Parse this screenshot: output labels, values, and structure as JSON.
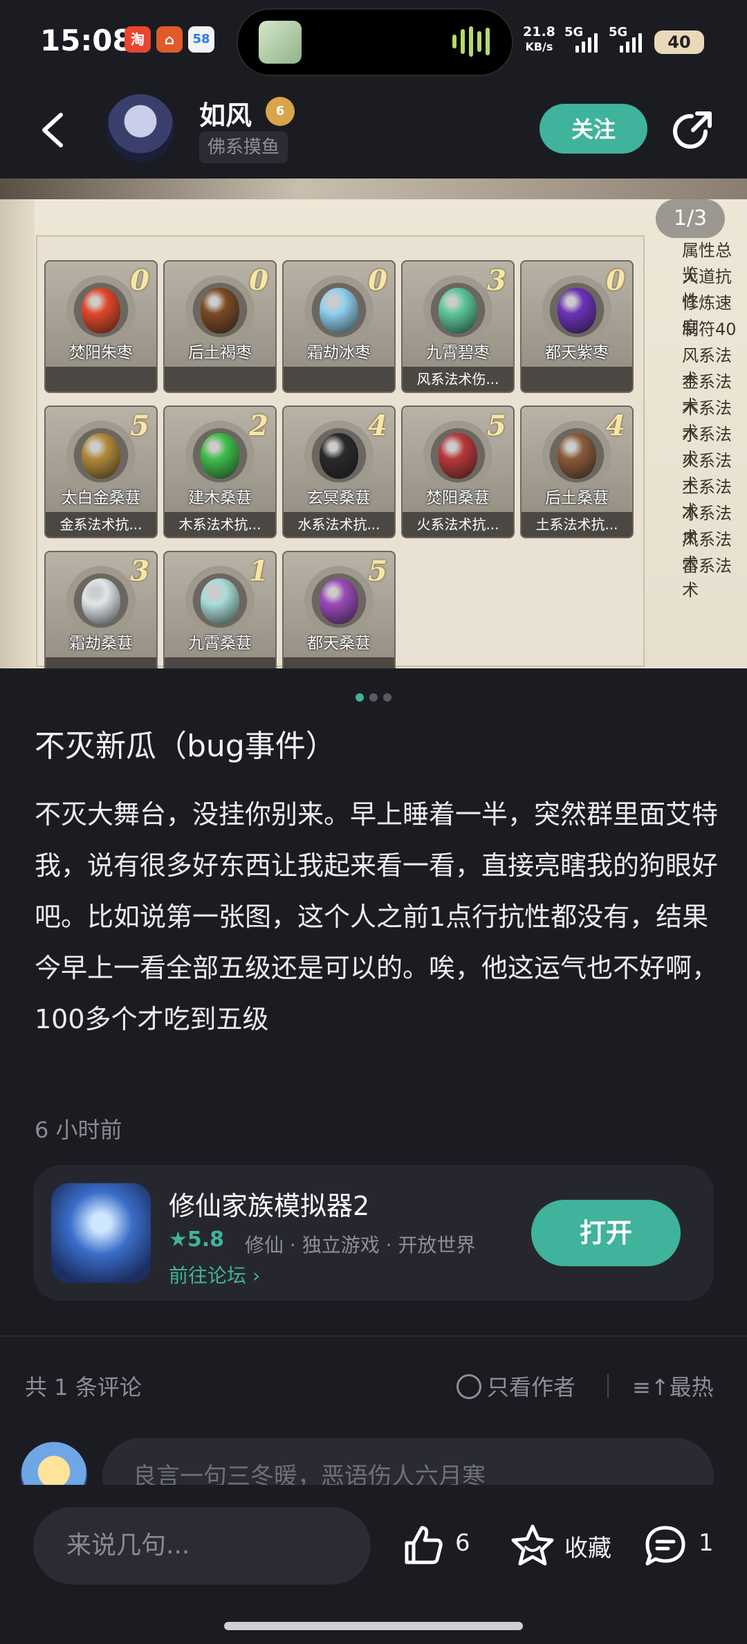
{
  "status_bar": {
    "time": "15:08",
    "net_speed_value": "21.8",
    "net_speed_unit": "KB/s",
    "signal1": "5G",
    "signal2": "5G",
    "battery": "40",
    "badge_58": "58"
  },
  "header": {
    "username": "如风",
    "level_badge": "6",
    "subtitle": "佛系摸鱼",
    "follow_label": "关注"
  },
  "image": {
    "counter": "1/3",
    "items": [
      {
        "name": "焚阳朱枣",
        "count": "0",
        "desc": "",
        "color": "#e0482a"
      },
      {
        "name": "后土褐枣",
        "count": "0",
        "desc": "",
        "color": "#7a4a24"
      },
      {
        "name": "霜劫冰枣",
        "count": "0",
        "desc": "",
        "color": "#8fd0ee"
      },
      {
        "name": "九霄碧枣",
        "count": "3",
        "desc": "风系法术伤...",
        "color": "#5cc79a"
      },
      {
        "name": "都天紫枣",
        "count": "0",
        "desc": "",
        "color": "#6a32b8"
      },
      {
        "name": "太白金桑葚",
        "count": "5",
        "desc": "金系法术抗...",
        "color": "#b08a3a"
      },
      {
        "name": "建木桑葚",
        "count": "2",
        "desc": "木系法术抗...",
        "color": "#3fbf4a"
      },
      {
        "name": "玄冥桑葚",
        "count": "4",
        "desc": "水系法术抗...",
        "color": "#2a2a2a"
      },
      {
        "name": "焚阳桑葚",
        "count": "5",
        "desc": "火系法术抗...",
        "color": "#b8383a"
      },
      {
        "name": "后土桑葚",
        "count": "4",
        "desc": "土系法术抗...",
        "color": "#8a5a3a"
      },
      {
        "name": "霜劫桑葚",
        "count": "3",
        "desc": "",
        "color": "#dfe6ea"
      },
      {
        "name": "九霄桑葚",
        "count": "1",
        "desc": "",
        "color": "#a9dcd8"
      },
      {
        "name": "都天桑葚",
        "count": "5",
        "desc": "",
        "color": "#9a4ab8"
      }
    ],
    "side_list": [
      "属性总览",
      "大道抗性",
      "修炼速度",
      "制符40",
      "风系法术",
      "金系法术",
      "木系法术",
      "水系法术",
      "火系法术",
      "土系法术",
      "冰系法术",
      "风系法术",
      "雷系法术"
    ]
  },
  "post": {
    "title": "不灭新瓜（bug事件）",
    "body": "不灭大舞台，没挂你别来。早上睡着一半，突然群里面艾特我，说有很多好东西让我起来看一看，直接亮瞎我的狗眼好吧。比如说第一张图，这个人之前1点行抗性都没有，结果今早上一看全部五级还是可以的。唉，他这运气也不好啊，100多个才吃到五级",
    "time": "6 小时前"
  },
  "game_card": {
    "name": "修仙家族模拟器2",
    "rating": "5.8",
    "tags": "修仙 · 独立游戏 · 开放世界",
    "forum_link": "前往论坛",
    "open_label": "打开"
  },
  "comments": {
    "count_label": "共 1 条评论",
    "author_only": "只看作者",
    "sort": "最热",
    "input_placeholder": "良言一句三冬暖，恶语伤人六月寒"
  },
  "bottom_bar": {
    "input_placeholder": "来说几句...",
    "like_count": "6",
    "fav_label": "收藏",
    "comment_count": "1"
  },
  "colors": {
    "accent": "#3fb39b",
    "background": "#1b1c22",
    "card": "#26272e"
  }
}
